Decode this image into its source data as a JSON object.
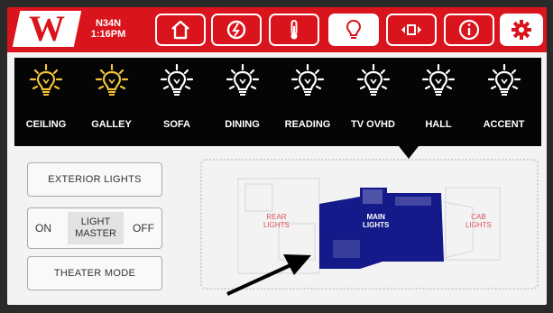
{
  "topbar": {
    "logo_letter": "W",
    "location_line1": "N34N",
    "location_line2": "1:16PM",
    "nav": [
      {
        "name": "home-icon",
        "active": false
      },
      {
        "name": "power-icon",
        "active": false
      },
      {
        "name": "thermometer-icon",
        "active": false
      },
      {
        "name": "lightbulb-icon",
        "active": true
      },
      {
        "name": "slideout-icon",
        "active": false
      },
      {
        "name": "info-icon",
        "active": false
      },
      {
        "name": "settings-gear-icon",
        "active": false
      }
    ]
  },
  "lights": [
    {
      "label": "CEILING",
      "state": "on"
    },
    {
      "label": "GALLEY",
      "state": "on"
    },
    {
      "label": "SOFA",
      "state": "off"
    },
    {
      "label": "DINING",
      "state": "off"
    },
    {
      "label": "READING",
      "state": "off"
    },
    {
      "label": "TV OVHD",
      "state": "off"
    },
    {
      "label": "HALL",
      "state": "off"
    },
    {
      "label": "ACCENT",
      "state": "off"
    }
  ],
  "colors": {
    "brand_red": "#d9141c",
    "light_on": "#f2c23a",
    "light_off": "#ffffff"
  },
  "controls": {
    "exterior_lights": "EXTERIOR LIGHTS",
    "master_on": "ON",
    "master_line1": "LIGHT",
    "master_line2": "MASTER",
    "master_off": "OFF",
    "theater_mode": "THEATER MODE"
  },
  "floorplan": {
    "rear_line1": "REAR",
    "rear_line2": "LIGHTS",
    "main_line1": "MAIN",
    "main_line2": "LIGHTS",
    "cab_line1": "CAB",
    "cab_line2": "LIGHTS"
  }
}
